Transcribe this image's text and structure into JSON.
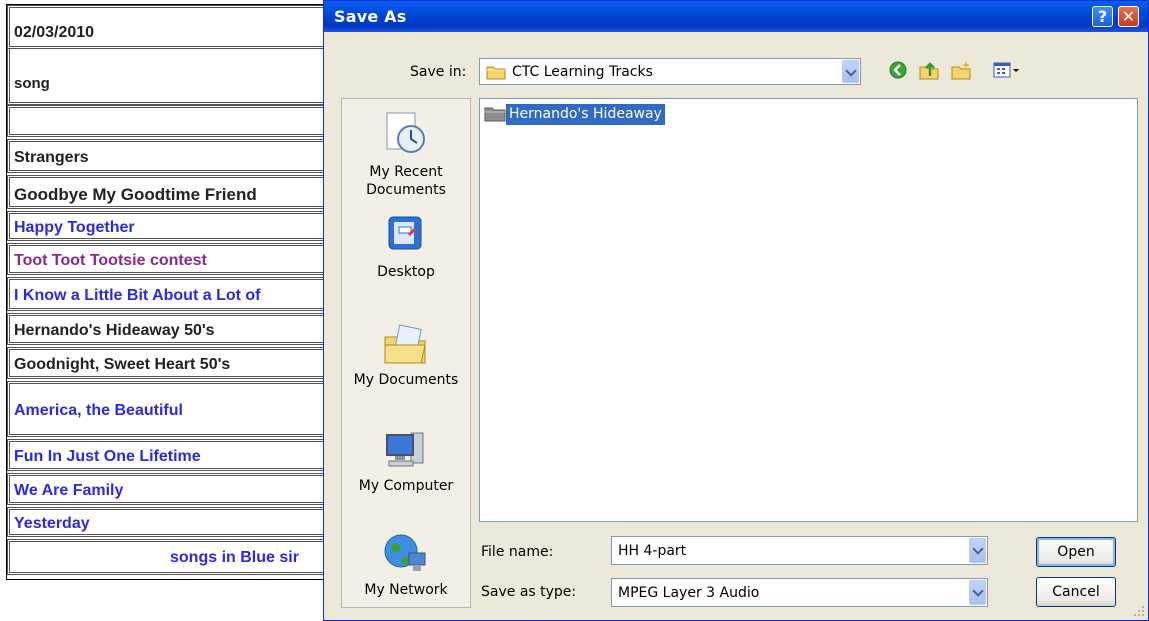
{
  "background_page": {
    "rows": [
      {
        "text": "02/03/2010",
        "color": "black"
      },
      {
        "text": "song",
        "color": "black"
      },
      {
        "text": "",
        "color": "black"
      },
      {
        "text": "Strangers",
        "color": "black"
      },
      {
        "text": "Goodbye My Goodtime Friend",
        "color": "black"
      },
      {
        "text": "Happy Together",
        "color": "blue"
      },
      {
        "text": "Toot Toot Tootsie contest",
        "color": "purple"
      },
      {
        "text": "I Know a Little Bit About a Lot of",
        "color": "blue"
      },
      {
        "text": "Hernando's Hideaway 50's",
        "color": "black"
      },
      {
        "text": "Goodnight, Sweet Heart 50's",
        "color": "black"
      },
      {
        "text": "America, the Beautiful",
        "color": "blue"
      },
      {
        "text": "Fun In Just One Lifetime",
        "color": "blue"
      },
      {
        "text": "We Are Family",
        "color": "blue"
      },
      {
        "text": "Yesterday",
        "color": "blue"
      },
      {
        "text": "songs in Blue sir",
        "color": "blue"
      }
    ]
  },
  "dialog": {
    "title": "Save As",
    "help_glyph": "?",
    "close_glyph": "✕",
    "save_in_label": "Save in:",
    "save_in_value": "CTC Learning Tracks",
    "toolbar_icons": [
      "back-icon",
      "up-folder-icon",
      "new-folder-icon",
      "views-menu-icon"
    ],
    "places": [
      {
        "label": "My Recent Documents",
        "icon": "recent-documents-icon"
      },
      {
        "label": "Desktop",
        "icon": "desktop-icon"
      },
      {
        "label": "My Documents",
        "icon": "my-documents-icon"
      },
      {
        "label": "My Computer",
        "icon": "my-computer-icon"
      },
      {
        "label": "My Network",
        "icon": "my-network-icon"
      }
    ],
    "files": [
      {
        "name": "Hernando's Hideaway",
        "type": "folder",
        "selected": true
      }
    ],
    "file_name_label": "File name:",
    "file_name_value": "HH 4-part",
    "save_type_label": "Save as type:",
    "save_type_value": "MPEG Layer 3 Audio",
    "open_button": "Open",
    "cancel_button": "Cancel"
  },
  "colors": {
    "titlebar": "#0046d5",
    "dialog_bg": "#ece9d8",
    "selection": "#316ac5",
    "blue_text": "#2a2ae6",
    "purple_text": "#8a2a8a"
  }
}
